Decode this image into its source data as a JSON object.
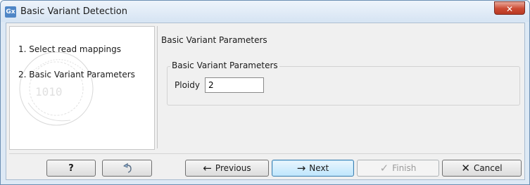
{
  "window": {
    "icon_text": "Gx",
    "title": "Basic Variant Detection",
    "close_label": "✕"
  },
  "steps": [
    {
      "label": "1.  Select read mappings"
    },
    {
      "label": "2.  Basic Variant Parameters"
    }
  ],
  "panel": {
    "header": "Basic Variant Parameters",
    "group_title": "Basic Variant Parameters",
    "ploidy_label": "Ploidy",
    "ploidy_value": "2"
  },
  "buttons": {
    "help_label": "?",
    "previous_label": "Previous",
    "next_label": "Next",
    "finish_label": "Finish",
    "cancel_label": "Cancel",
    "finish_enabled": false
  },
  "icons": {
    "help": "help-icon",
    "reset": "reset-icon",
    "previous": "arrow-left-icon",
    "next": "arrow-right-icon",
    "finish": "checkmark-icon",
    "cancel": "cancel-x-icon"
  }
}
